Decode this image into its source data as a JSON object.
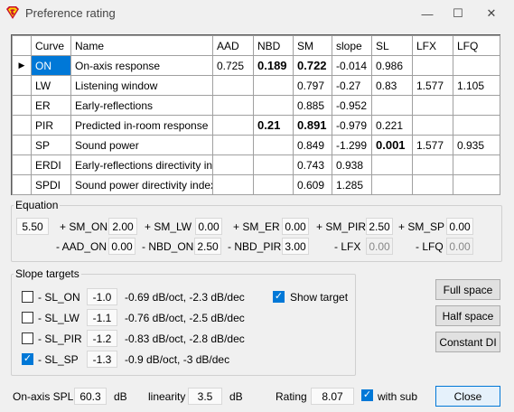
{
  "window": {
    "title": "Preference rating",
    "minimize_label": "—",
    "maximize_label": "☐",
    "close_label": "✕"
  },
  "table": {
    "headers": [
      "Curve",
      "Name",
      "AAD",
      "NBD",
      "SM",
      "slope",
      "SL",
      "LFX",
      "LFQ"
    ],
    "rows": [
      {
        "curve": "ON",
        "name": "On-axis response",
        "aad": "0.725",
        "nbd": "0.189",
        "sm": "0.722",
        "slope": "-0.014",
        "sl": "0.986",
        "lfx": "",
        "lfq": ""
      },
      {
        "curve": "LW",
        "name": "Listening window",
        "aad": "",
        "nbd": "",
        "sm": "0.797",
        "slope": "-0.27",
        "sl": "0.83",
        "lfx": "1.577",
        "lfq": "1.105"
      },
      {
        "curve": "ER",
        "name": "Early-reflections",
        "aad": "",
        "nbd": "",
        "sm": "0.885",
        "slope": "-0.952",
        "sl": "",
        "lfx": "",
        "lfq": ""
      },
      {
        "curve": "PIR",
        "name": "Predicted in-room response",
        "aad": "",
        "nbd": "0.21",
        "sm": "0.891",
        "slope": "-0.979",
        "sl": "0.221",
        "lfx": "",
        "lfq": ""
      },
      {
        "curve": "SP",
        "name": "Sound power",
        "aad": "",
        "nbd": "",
        "sm": "0.849",
        "slope": "-1.299",
        "sl": "0.001",
        "lfx": "1.577",
        "lfq": "0.935"
      },
      {
        "curve": "ERDI",
        "name": "Early-reflections directivity index",
        "aad": "",
        "nbd": "",
        "sm": "0.743",
        "slope": "0.938",
        "sl": "",
        "lfx": "",
        "lfq": ""
      },
      {
        "curve": "SPDI",
        "name": "Sound power directivity index",
        "aad": "",
        "nbd": "",
        "sm": "0.609",
        "slope": "1.285",
        "sl": "",
        "lfx": "",
        "lfq": ""
      }
    ]
  },
  "equation": {
    "legend": "Equation",
    "constant": "5.50",
    "sm_on_label": "+ SM_ON",
    "sm_on": "2.00",
    "sm_lw_label": "+ SM_LW",
    "sm_lw": "0.00",
    "sm_er_label": "+ SM_ER",
    "sm_er": "0.00",
    "sm_pir_label": "+ SM_PIR",
    "sm_pir": "2.50",
    "sm_sp_label": "+ SM_SP",
    "sm_sp": "0.00",
    "aad_on_label": "- AAD_ON",
    "aad_on": "0.00",
    "nbd_on_label": "- NBD_ON",
    "nbd_on": "2.50",
    "nbd_pir_label": "- NBD_PIR",
    "nbd_pir": "3.00",
    "lfx_label": "- LFX",
    "lfx": "0.00",
    "lfq_label": "- LFQ",
    "lfq": "0.00"
  },
  "slope_targets": {
    "legend": "Slope targets",
    "items": [
      {
        "label": "- SL_ON",
        "value": "-1.0",
        "desc": "-0.69 dB/oct, -2.3 dB/dec",
        "checked": false
      },
      {
        "label": "- SL_LW",
        "value": "-1.1",
        "desc": "-0.76 dB/oct, -2.5 dB/dec",
        "checked": false
      },
      {
        "label": "- SL_PIR",
        "value": "-1.2",
        "desc": "-0.83 dB/oct, -2.8 dB/dec",
        "checked": false
      },
      {
        "label": "- SL_SP",
        "value": "-1.3",
        "desc": "-0.9 dB/oct, -3 dB/dec",
        "checked": true
      }
    ],
    "show_target_label": "Show target",
    "show_target_checked": true
  },
  "buttons": {
    "full_space": "Full space",
    "half_space": "Half space",
    "constant_di": "Constant DI",
    "close": "Close"
  },
  "footer": {
    "spl_label": "On-axis SPL",
    "spl_value": "60.3",
    "spl_unit": "dB",
    "linearity_label": "linearity",
    "linearity_value": "3.5",
    "linearity_unit": "dB",
    "rating_label": "Rating",
    "rating_value": "8.07",
    "with_sub_label": "with sub",
    "with_sub_checked": true
  },
  "colors": {
    "accent": "#0078d7",
    "row_selected": "#0078d7"
  },
  "icons": {
    "app": "superman-shield-icon",
    "row_pointer": "row-pointer-icon",
    "check": "check-icon"
  }
}
